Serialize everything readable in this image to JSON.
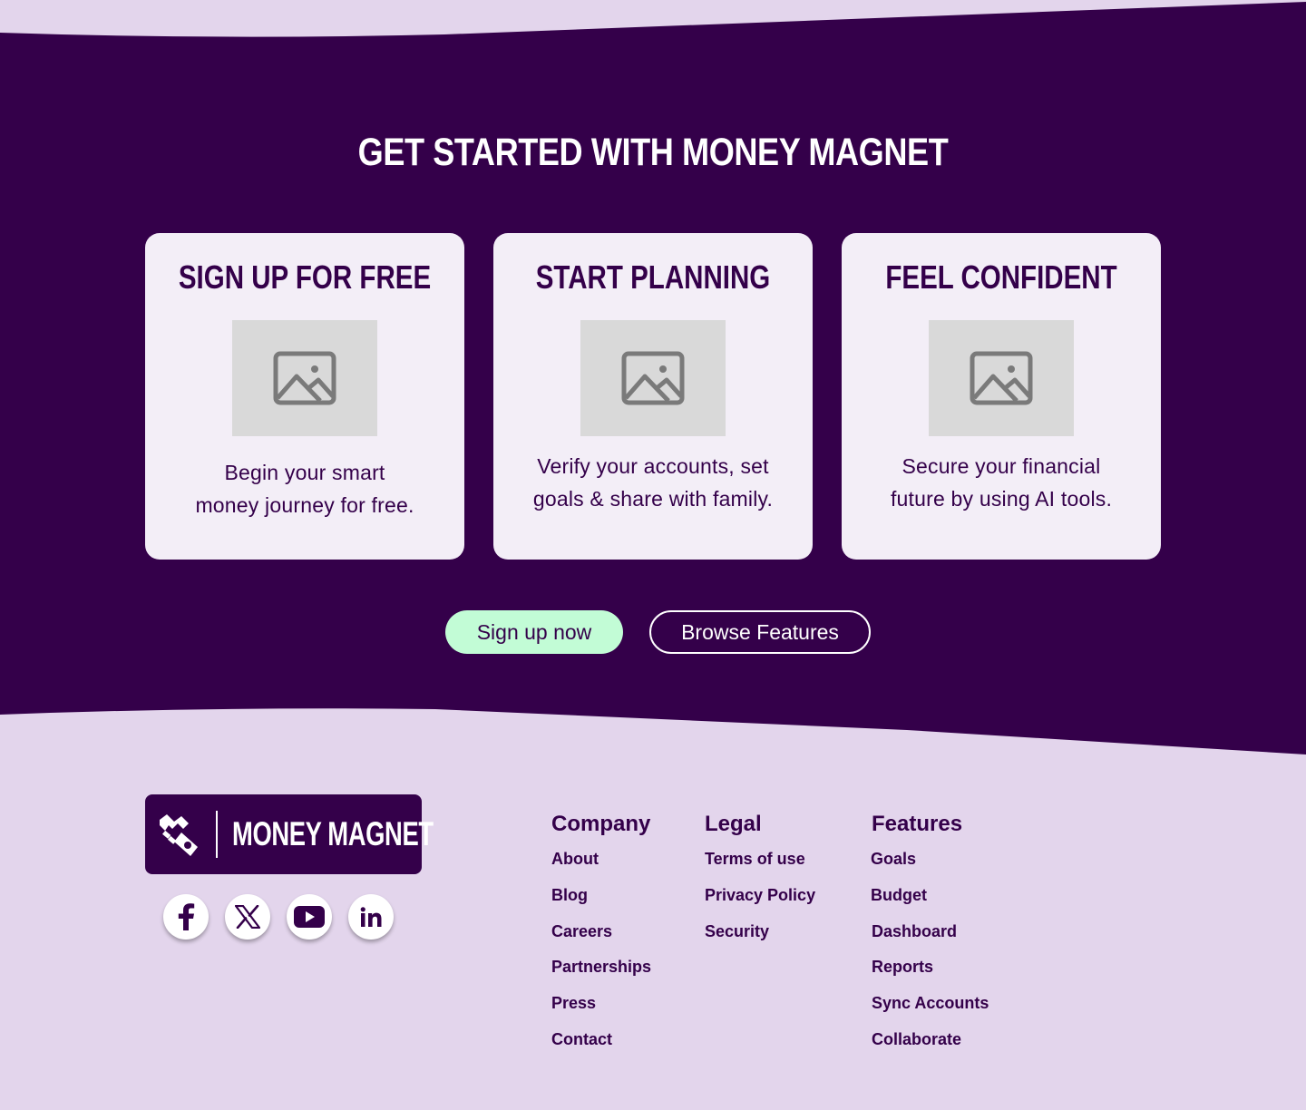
{
  "colors": {
    "hero_bg": "#34004a",
    "footer_bg": "#e3d5ec",
    "card_bg": "#f3eef7",
    "primary_button_bg": "#c2fcd6",
    "text_dark": "#34004a",
    "placeholder_bg": "#d9d9d9",
    "placeholder_icon": "#7a7a7a"
  },
  "hero": {
    "title": "GET STARTED WITH MONEY MAGNET",
    "cards": [
      {
        "title": "SIGN UP FOR FREE",
        "image_icon": "image-placeholder-icon",
        "text_line1": "Begin your smart",
        "text_line2": "money journey for free."
      },
      {
        "title": "START PLANNING",
        "image_icon": "image-placeholder-icon",
        "text_line1": "Verify your accounts, set",
        "text_line2": "goals & share with family."
      },
      {
        "title": "FEEL CONFIDENT",
        "image_icon": "image-placeholder-icon",
        "text_line1": "Secure your financial",
        "text_line2": "future by using AI tools."
      }
    ],
    "primary_button": "Sign up now",
    "secondary_button": "Browse Features"
  },
  "footer": {
    "logo_text": "MONEY MAGNET",
    "social": [
      {
        "icon": "facebook-icon"
      },
      {
        "icon": "x-icon"
      },
      {
        "icon": "youtube-icon"
      },
      {
        "icon": "linkedin-icon"
      }
    ],
    "columns": [
      {
        "heading": "Company",
        "links": [
          "About",
          "Blog",
          "Careers",
          "Partnerships",
          "Press",
          "Contact"
        ]
      },
      {
        "heading": "Legal",
        "links": [
          "Terms of use",
          "Privacy Policy",
          "Security"
        ]
      },
      {
        "heading": "Features",
        "links": [
          "Goals",
          "Budget",
          "Dashboard",
          "Reports",
          "Sync Accounts",
          "Collaborate"
        ]
      }
    ]
  }
}
